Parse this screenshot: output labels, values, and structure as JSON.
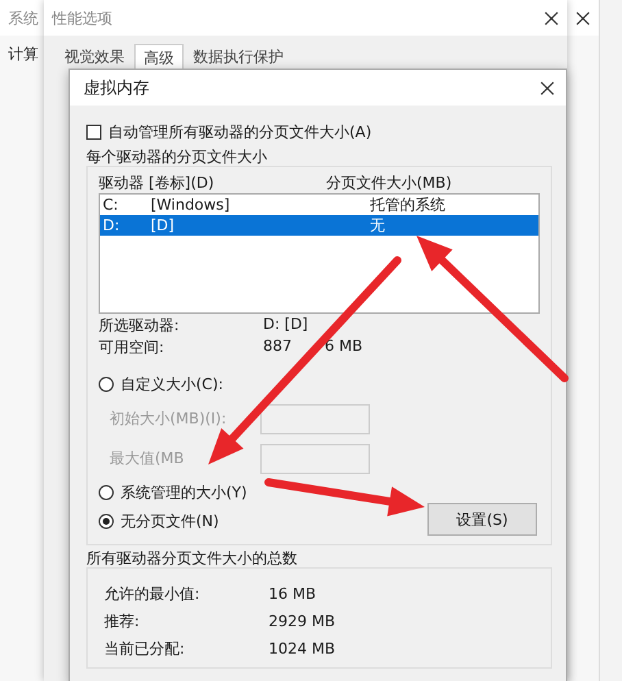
{
  "background_window": {
    "title": "系统",
    "tab": "计算"
  },
  "performance_window": {
    "title": "性能选项",
    "tabs": [
      {
        "label": "视觉效果",
        "selected": false
      },
      {
        "label": "高级",
        "selected": true
      },
      {
        "label": "数据执行保护",
        "selected": false
      }
    ]
  },
  "dialog": {
    "title": "虚拟内存",
    "auto_manage": {
      "label": "自动管理所有驱动器的分页文件大小(A)",
      "checked": false
    },
    "drives_group": {
      "title": "每个驱动器的分页文件大小",
      "columns": [
        "驱动器 [卷标](D)",
        "分页文件大小(MB)"
      ],
      "rows": [
        {
          "drive": "C:",
          "volume": "[Windows]",
          "size": "托管的系统",
          "selected": false
        },
        {
          "drive": "D:",
          "volume": "[D]",
          "size": "无",
          "selected": true
        }
      ],
      "selected_drive": {
        "label": "所选驱动器:",
        "value": "D:  [D]"
      },
      "free_space": {
        "label": "可用空间:",
        "value_start": "887",
        "value_end": "6 MB"
      },
      "options": [
        {
          "kind": "radio",
          "label": "自定义大小(C):",
          "selected": false
        },
        {
          "kind": "field",
          "label": "初始大小(MB)(I):",
          "disabled": true
        },
        {
          "kind": "field",
          "label": "最大值(MB",
          "disabled": true
        },
        {
          "kind": "radio",
          "label": "系统管理的大小(Y)",
          "selected": false
        },
        {
          "kind": "radio",
          "label": "无分页文件(N)",
          "selected": true
        }
      ],
      "set_button": "设置(S)"
    },
    "totals_group": {
      "title": "所有驱动器分页文件大小的总数",
      "rows": [
        {
          "label": "允许的最小值:",
          "value": "16 MB"
        },
        {
          "label": "推荐:",
          "value": "2929 MB"
        },
        {
          "label": "当前已分配:",
          "value": "1024 MB"
        }
      ]
    }
  },
  "annotations": [
    {
      "kind": "arrow"
    },
    {
      "kind": "arrow"
    },
    {
      "kind": "arrow"
    }
  ]
}
